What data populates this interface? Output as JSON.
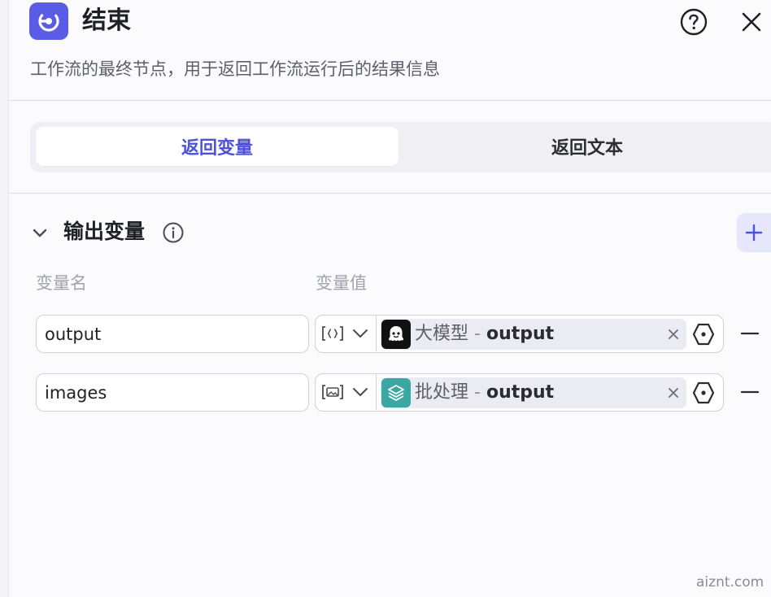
{
  "header": {
    "title": "结束",
    "description": "工作流的最终节点，用于返回工作流运行后的结果信息",
    "node_icon": "end-node-icon",
    "help_icon": "help-circle-icon",
    "close_icon": "close-icon"
  },
  "tabs": [
    {
      "label": "返回变量",
      "active": true
    },
    {
      "label": "返回文本",
      "active": false
    }
  ],
  "output_section": {
    "title": "输出变量",
    "columns": {
      "name": "变量名",
      "value": "变量值"
    },
    "rows": [
      {
        "name": "output",
        "type_icon": "object-type-icon",
        "ref_node": "大模型",
        "ref_sep": " - ",
        "ref_var": "output",
        "node_icon": "llm-node-icon"
      },
      {
        "name": "images",
        "type_icon": "image-type-icon",
        "ref_node": "批处理",
        "ref_sep": " - ",
        "ref_var": "output",
        "node_icon": "batch-node-icon"
      }
    ]
  },
  "colors": {
    "accent": "#5b5ce6",
    "active_tab_text": "#4d52d8",
    "batch_icon_bg": "#3ba7a3"
  },
  "watermark": "aiznt.com"
}
